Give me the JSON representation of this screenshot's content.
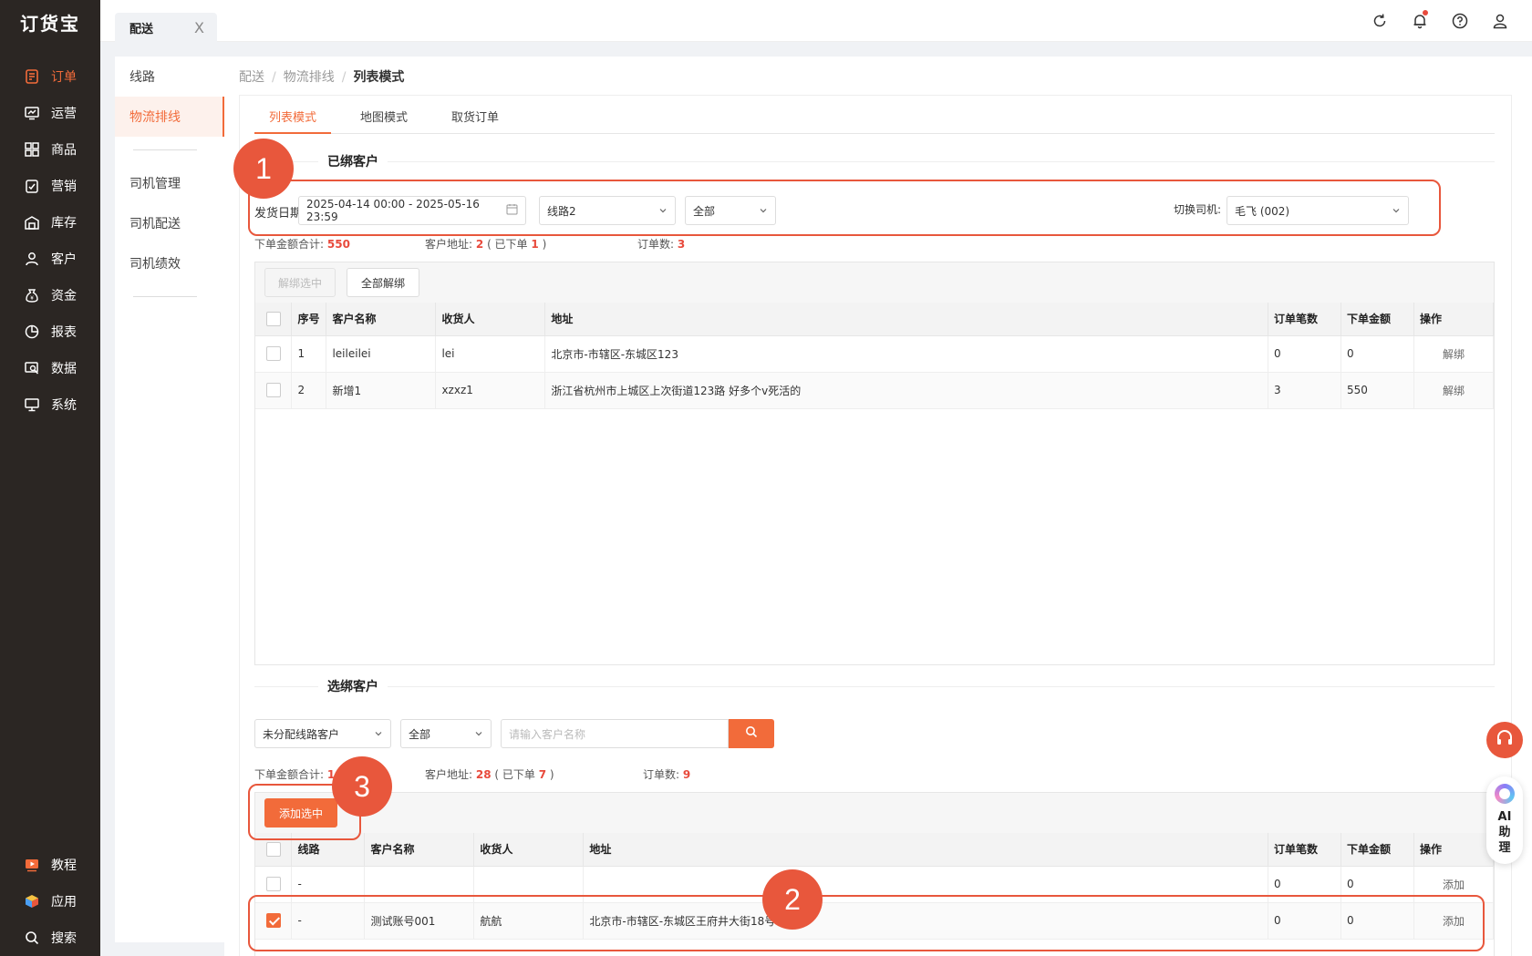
{
  "app": {
    "logo": "订货宝"
  },
  "sidebar": {
    "items": [
      {
        "label": "订单",
        "icon": "order-icon",
        "active": true
      },
      {
        "label": "运营",
        "icon": "operation-icon"
      },
      {
        "label": "商品",
        "icon": "goods-icon"
      },
      {
        "label": "营销",
        "icon": "marketing-icon"
      },
      {
        "label": "库存",
        "icon": "warehouse-icon"
      },
      {
        "label": "客户",
        "icon": "customer-icon"
      },
      {
        "label": "资金",
        "icon": "money-bag-icon"
      },
      {
        "label": "报表",
        "icon": "pie-chart-icon"
      },
      {
        "label": "数据",
        "icon": "data-icon"
      },
      {
        "label": "系统",
        "icon": "monitor-icon"
      }
    ],
    "bottom": [
      {
        "label": "教程",
        "icon": "video-icon"
      },
      {
        "label": "应用",
        "icon": "cube-icon"
      },
      {
        "label": "搜索",
        "icon": "search-icon"
      }
    ]
  },
  "topbar": {
    "tab": "配送",
    "tab_close": "X"
  },
  "submenu": {
    "group1": [
      "线路",
      "物流排线"
    ],
    "group2": [
      "司机管理",
      "司机配送",
      "司机绩效"
    ]
  },
  "breadcrumb": [
    "配送",
    "物流排线",
    "列表模式"
  ],
  "tabs": [
    "列表模式",
    "地图模式",
    "取货订单"
  ],
  "bound": {
    "title": "已绑客户",
    "date_label": "发货日期",
    "date_range": "2025-04-14 00:00 - 2025-05-16 23:59",
    "route_select": "线路2",
    "status_select": "全部",
    "driver_label": "切换司机:",
    "driver_select": "毛飞 (002)",
    "sum_amount_label": "下单金额合计:",
    "sum_amount": "550",
    "addr_label": "客户地址:",
    "addr_count": "2",
    "addr_ordered_pre": "( 已下单",
    "addr_ordered": "1",
    "addr_ordered_post": ")",
    "order_count_label": "订单数:",
    "order_count": "3",
    "btn_unbind_selected": "解绑选中",
    "btn_unbind_all": "全部解绑",
    "columns": [
      "序号",
      "客户名称",
      "收货人",
      "地址",
      "订单笔数",
      "下单金额",
      "操作"
    ],
    "rows": [
      {
        "no": "1",
        "name": "leileilei",
        "receiver": "lei",
        "address": "北京市-市辖区-东城区123",
        "orders": "0",
        "amount": "0",
        "op": "解绑"
      },
      {
        "no": "2",
        "name": "新增1",
        "receiver": "xzxz1",
        "address": "浙江省杭州市上城区上次街道123路 好多个v死活的",
        "orders": "3",
        "amount": "550",
        "op": "解绑"
      }
    ]
  },
  "select": {
    "title": "选绑客户",
    "filter_select": "未分配线路客户",
    "status_select": "全部",
    "search_placeholder": "请输入客户名称",
    "sum_amount_label": "下单金额合计:",
    "sum_amount": "14",
    "addr_label": "客户地址:",
    "addr_count": "28",
    "addr_ordered_pre": "( 已下单",
    "addr_ordered": "7",
    "addr_ordered_post": ")",
    "order_count_label": "订单数:",
    "order_count": "9",
    "btn_add_selected": "添加选中",
    "columns": [
      "线路",
      "客户名称",
      "收货人",
      "地址",
      "订单笔数",
      "下单金额",
      "操作"
    ],
    "rows": [
      {
        "route": "-",
        "name": "",
        "receiver": "",
        "address": "",
        "orders": "0",
        "amount": "0",
        "op": "添加",
        "checked": false
      },
      {
        "route": "-",
        "name": "测试账号001",
        "receiver": "航航",
        "address": "北京市-市辖区-东城区王府井大街18号",
        "orders": "0",
        "amount": "0",
        "op": "添加",
        "checked": true
      }
    ]
  },
  "annotations": [
    "1",
    "2",
    "3"
  ],
  "float": {
    "ai_chars": [
      "AI",
      "助",
      "理"
    ]
  },
  "colors": {
    "accent": "#f26b3a",
    "sidebar": "#2b2623",
    "annotation": "#e8573c",
    "alert": "#e84a3c"
  }
}
